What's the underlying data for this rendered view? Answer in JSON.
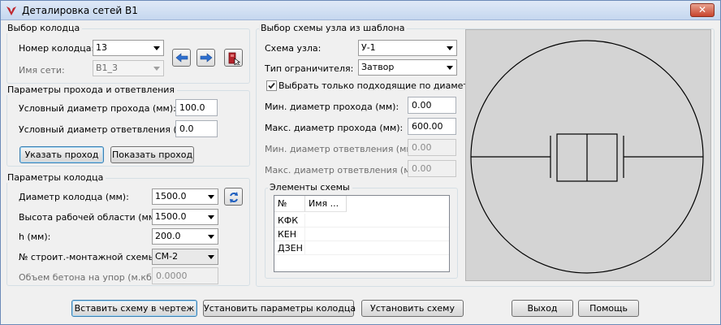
{
  "window": {
    "title": "Деталировка сетей В1",
    "close_label": "✕"
  },
  "well_select": {
    "legend": "Выбор колодца",
    "well_number_label": "Номер колодца:",
    "well_number_value": "13",
    "network_name_label": "Имя сети:",
    "network_name_value": "В1_3"
  },
  "pass_params": {
    "legend": "Параметры прохода и ответвления",
    "pass_dia_label": "Условный диаметр прохода (мм):",
    "pass_dia_value": "100.0",
    "branch_dia_label": "Условный диаметр ответвления (мм)",
    "branch_dia_value": "0.0",
    "specify_btn": "Указать проход",
    "show_btn": "Показать проход"
  },
  "well_params": {
    "legend": "Параметры колодца",
    "diameter_label": "Диаметр колодца (мм):",
    "diameter_value": "1500.0",
    "work_height_label": "Высота рабочей области (мм):",
    "work_height_value": "1500.0",
    "h_label": "h (мм):",
    "h_value": "200.0",
    "scheme_no_label": "№ строит.-монтажной схемы:",
    "scheme_no_value": "СМ-2",
    "concrete_label": "Объем бетона на упор (м.кб.):",
    "concrete_value": "0.0000"
  },
  "template": {
    "legend": "Выбор схемы узла из шаблона",
    "scheme_label": "Схема узла:",
    "scheme_value": "У-1",
    "limiter_label": "Тип ограничителя:",
    "limiter_value": "Затвор",
    "only_matching_label": "Выбрать только подходящие по диаметру",
    "only_matching_checked": true,
    "min_pass_label": "Мин. диаметр прохода (мм):",
    "min_pass_value": "0.00",
    "max_pass_label": "Макс. диаметр прохода (мм):",
    "max_pass_value": "600.00",
    "min_branch_label": "Мин. диаметр ответвления (мм):",
    "min_branch_value": "0.00",
    "max_branch_label": "Макс. диаметр ответвления (мм):",
    "max_branch_value": "0.00"
  },
  "elements": {
    "legend": "Элементы схемы",
    "columns": [
      "№",
      "Имя ..."
    ],
    "rows": [
      "КФК",
      "КЕН",
      "ДЗЕН"
    ]
  },
  "buttons": {
    "insert": "Вставить схему в чертеж",
    "set_params": "Установить параметры колодца",
    "set_scheme": "Установить схему",
    "exit": "Выход",
    "help": "Помощь"
  }
}
